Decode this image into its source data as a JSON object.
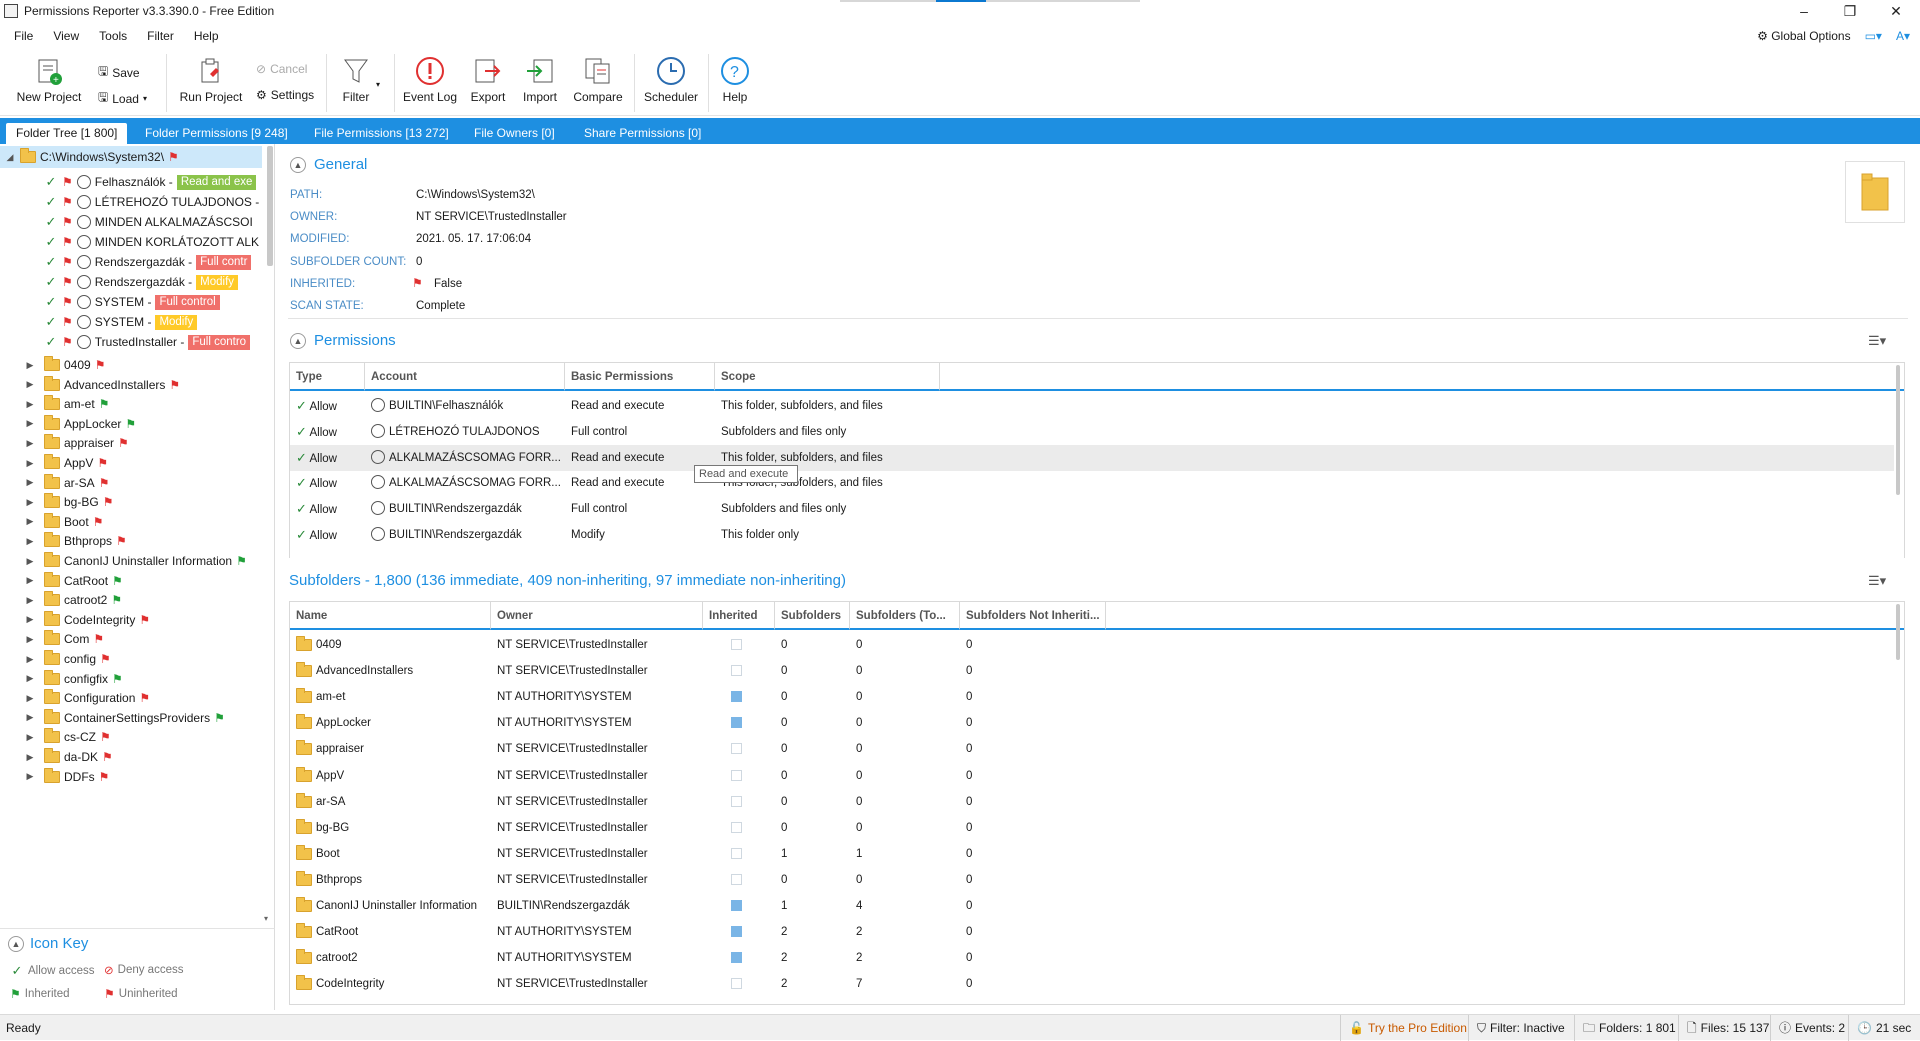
{
  "window": {
    "title": "Permissions Reporter v3.3.390.0 - Free Edition",
    "controls": [
      "–",
      "❐",
      "✕"
    ]
  },
  "menu": {
    "items": [
      "File",
      "View",
      "Tools",
      "Filter",
      "Help"
    ],
    "global_options": "Global Options"
  },
  "ribbon": {
    "new_project": "New Project",
    "save": "Save",
    "load": "Load",
    "run_project": "Run Project",
    "cancel": "Cancel",
    "settings": "Settings",
    "filter": "Filter",
    "event_log": "Event Log",
    "export": "Export",
    "import": "Import",
    "compare": "Compare",
    "scheduler": "Scheduler",
    "help": "Help"
  },
  "tabs": [
    {
      "label": "Folder Tree [1 800]"
    },
    {
      "label": "Folder Permissions [9 248]"
    },
    {
      "label": "File Permissions [13 272]"
    },
    {
      "label": "File Owners [0]"
    },
    {
      "label": "Share Permissions [0]"
    }
  ],
  "tree": {
    "root": "C:\\Windows\\System32\\",
    "entries": [
      {
        "account": "Felhasználók -",
        "badge": "Read and exe",
        "badge_color": "#8bc34a"
      },
      {
        "account": "LÉTREHOZÓ TULAJDONOS -",
        "badge": "",
        "badge_color": ""
      },
      {
        "account": "MINDEN ALKALMAZÁSCSOI",
        "badge": "",
        "badge_color": ""
      },
      {
        "account": "MINDEN KORLÁTOZOTT ALK",
        "badge": "",
        "badge_color": ""
      },
      {
        "account": "Rendszergazdák -",
        "badge": "Full contr",
        "badge_color": "#f0706a"
      },
      {
        "account": "Rendszergazdák -",
        "badge": "Modify",
        "badge_color": "#ffca28"
      },
      {
        "account": "SYSTEM -",
        "badge": "Full control",
        "badge_color": "#f0706a"
      },
      {
        "account": "SYSTEM -",
        "badge": "Modify",
        "badge_color": "#ffca28"
      },
      {
        "account": "TrustedInstaller -",
        "badge": "Full contro",
        "badge_color": "#f0706a"
      }
    ],
    "folders": [
      {
        "name": "0409",
        "flag": "red"
      },
      {
        "name": "AdvancedInstallers",
        "flag": "red"
      },
      {
        "name": "am-et",
        "flag": "green"
      },
      {
        "name": "AppLocker",
        "flag": "green"
      },
      {
        "name": "appraiser",
        "flag": "red"
      },
      {
        "name": "AppV",
        "flag": "red"
      },
      {
        "name": "ar-SA",
        "flag": "red"
      },
      {
        "name": "bg-BG",
        "flag": "red"
      },
      {
        "name": "Boot",
        "flag": "red"
      },
      {
        "name": "Bthprops",
        "flag": "red"
      },
      {
        "name": "CanonIJ Uninstaller Information",
        "flag": "green"
      },
      {
        "name": "CatRoot",
        "flag": "green"
      },
      {
        "name": "catroot2",
        "flag": "green"
      },
      {
        "name": "CodeIntegrity",
        "flag": "red"
      },
      {
        "name": "Com",
        "flag": "red"
      },
      {
        "name": "config",
        "flag": "red"
      },
      {
        "name": "configfix",
        "flag": "green"
      },
      {
        "name": "Configuration",
        "flag": "red"
      },
      {
        "name": "ContainerSettingsProviders",
        "flag": "green"
      },
      {
        "name": "cs-CZ",
        "flag": "red"
      },
      {
        "name": "da-DK",
        "flag": "red"
      },
      {
        "name": "DDFs",
        "flag": "red"
      }
    ]
  },
  "icon_key": {
    "title": "Icon Key",
    "allow": "Allow access",
    "deny": "Deny access",
    "inherited": "Inherited",
    "uninherited": "Uninherited"
  },
  "general": {
    "title": "General",
    "fields": [
      {
        "key": "PATH:",
        "value": "C:\\Windows\\System32\\"
      },
      {
        "key": "OWNER:",
        "value": "NT SERVICE\\TrustedInstaller"
      },
      {
        "key": "MODIFIED:",
        "value": "2021. 05. 17. 17:06:04"
      },
      {
        "key": "SUBFOLDER COUNT:",
        "value": "0"
      },
      {
        "key": "INHERITED:",
        "value": "False"
      },
      {
        "key": "SCAN STATE:",
        "value": "Complete"
      }
    ]
  },
  "permissions": {
    "title": "Permissions",
    "columns": [
      "Type",
      "Account",
      "Basic Permissions",
      "Scope"
    ],
    "rows": [
      {
        "type": "Allow",
        "account": "BUILTIN\\Felhasználók",
        "perm": "Read and execute",
        "scope": "This folder, subfolders, and files"
      },
      {
        "type": "Allow",
        "account": "LÉTREHOZÓ TULAJDONOS",
        "perm": "Full control",
        "scope": "Subfolders and files only"
      },
      {
        "type": "Allow",
        "account": "ALKALMAZÁSCSOMAG FORR...",
        "perm": "Read and execute",
        "scope": "This folder, subfolders, and files"
      },
      {
        "type": "Allow",
        "account": "ALKALMAZÁSCSOMAG FORR...",
        "perm": "Read and execute",
        "scope": "This folder, subfolders, and files"
      },
      {
        "type": "Allow",
        "account": "BUILTIN\\Rendszergazdák",
        "perm": "Full control",
        "scope": "Subfolders and files only"
      },
      {
        "type": "Allow",
        "account": "BUILTIN\\Rendszergazdák",
        "perm": "Modify",
        "scope": "This folder only"
      }
    ],
    "tooltip": "Read and execute"
  },
  "subfolders": {
    "title": "Subfolders - 1,800 (136 immediate, 409 non-inheriting, 97 immediate non-inheriting)",
    "columns": [
      "Name",
      "Owner",
      "Inherited",
      "Subfolders",
      "Subfolders (To...",
      "Subfolders Not Inheriti..."
    ],
    "rows": [
      {
        "name": "0409",
        "owner": "NT SERVICE\\TrustedInstaller",
        "inherited": false,
        "sub": "0",
        "total": "0",
        "noninh": "0"
      },
      {
        "name": "AdvancedInstallers",
        "owner": "NT SERVICE\\TrustedInstaller",
        "inherited": false,
        "sub": "0",
        "total": "0",
        "noninh": "0"
      },
      {
        "name": "am-et",
        "owner": "NT AUTHORITY\\SYSTEM",
        "inherited": true,
        "sub": "0",
        "total": "0",
        "noninh": "0"
      },
      {
        "name": "AppLocker",
        "owner": "NT AUTHORITY\\SYSTEM",
        "inherited": true,
        "sub": "0",
        "total": "0",
        "noninh": "0"
      },
      {
        "name": "appraiser",
        "owner": "NT SERVICE\\TrustedInstaller",
        "inherited": false,
        "sub": "0",
        "total": "0",
        "noninh": "0"
      },
      {
        "name": "AppV",
        "owner": "NT SERVICE\\TrustedInstaller",
        "inherited": false,
        "sub": "0",
        "total": "0",
        "noninh": "0"
      },
      {
        "name": "ar-SA",
        "owner": "NT SERVICE\\TrustedInstaller",
        "inherited": false,
        "sub": "0",
        "total": "0",
        "noninh": "0"
      },
      {
        "name": "bg-BG",
        "owner": "NT SERVICE\\TrustedInstaller",
        "inherited": false,
        "sub": "0",
        "total": "0",
        "noninh": "0"
      },
      {
        "name": "Boot",
        "owner": "NT SERVICE\\TrustedInstaller",
        "inherited": false,
        "sub": "1",
        "total": "1",
        "noninh": "0"
      },
      {
        "name": "Bthprops",
        "owner": "NT SERVICE\\TrustedInstaller",
        "inherited": false,
        "sub": "0",
        "total": "0",
        "noninh": "0"
      },
      {
        "name": "CanonIJ Uninstaller Information",
        "owner": "BUILTIN\\Rendszergazdák",
        "inherited": true,
        "sub": "1",
        "total": "4",
        "noninh": "0"
      },
      {
        "name": "CatRoot",
        "owner": "NT AUTHORITY\\SYSTEM",
        "inherited": true,
        "sub": "2",
        "total": "2",
        "noninh": "0"
      },
      {
        "name": "catroot2",
        "owner": "NT AUTHORITY\\SYSTEM",
        "inherited": true,
        "sub": "2",
        "total": "2",
        "noninh": "0"
      },
      {
        "name": "CodeIntegrity",
        "owner": "NT SERVICE\\TrustedInstaller",
        "inherited": false,
        "sub": "2",
        "total": "7",
        "noninh": "0"
      }
    ]
  },
  "status": {
    "ready": "Ready",
    "pro": "Try the Pro Edition",
    "filter": "Filter: Inactive",
    "folders": "Folders: 1 801",
    "files": "Files: 15 137",
    "events": "Events: 2",
    "time": "21 sec"
  },
  "colors": {
    "accent": "#1e8fe1",
    "allow": "#2a8a3a",
    "deny": "#e03030"
  }
}
